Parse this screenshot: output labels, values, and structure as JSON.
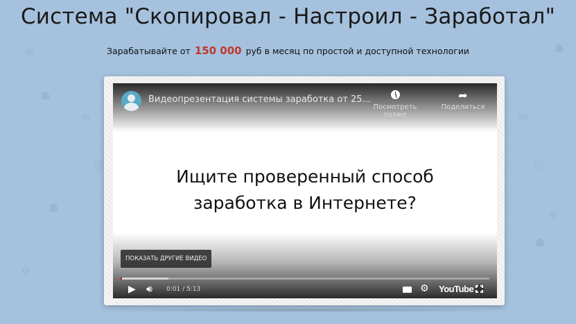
{
  "header": {
    "title": "Система \"Скопировал - Настроил - Заработал\"",
    "subtitle_prefix": "Зарабатывайте  от",
    "subtitle_amount": "150 000",
    "subtitle_suffix": "руб в месяц по простой и доступной технологии"
  },
  "colors": {
    "background": "#a5c1dd",
    "amount": "#c0392b",
    "progress_played": "#e00000"
  },
  "player": {
    "video_title": "Видеопрезентация системы заработка от 25...",
    "watch_later_label": "Посмотреть позже",
    "share_label": "Поделиться",
    "slide_line1": "Ищите проверенный способ",
    "slide_line2": "заработка в Интернете?",
    "more_videos_label": "ПОКАЗАТЬ ДРУГИЕ ВИДЕО",
    "time_display": "0:01 / 5:13",
    "progress_played_fraction": 0.003,
    "progress_loaded_fraction": 0.13,
    "youtube_label": "YouTube",
    "icons": [
      "channel-avatar",
      "clock-icon",
      "share-icon",
      "play-icon",
      "volume-icon",
      "subtitles-icon",
      "gear-icon",
      "fullscreen-icon"
    ]
  }
}
